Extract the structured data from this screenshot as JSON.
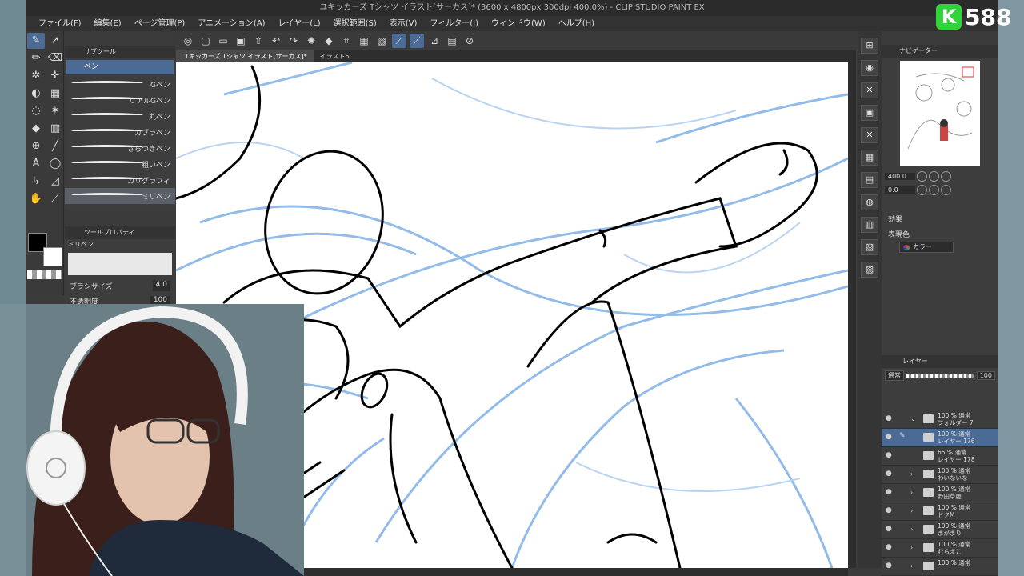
{
  "window": {
    "title": "ユキッカーズ Tシャツ イラスト[サーカス]* (3600 x 4800px 300dpi 400.0%) - CLIP STUDIO PAINT EX"
  },
  "menu": [
    "ファイル(F)",
    "編集(E)",
    "ページ管理(P)",
    "アニメーション(A)",
    "レイヤー(L)",
    "選択範囲(S)",
    "表示(V)",
    "フィルター(I)",
    "ウィンドウ(W)",
    "ヘルプ(H)"
  ],
  "subtool": {
    "header": "サブツール",
    "group": "ペン",
    "brushes": [
      "Gペン",
      "リアルGペン",
      "丸ペン",
      "カブラペン",
      "さらつきペン",
      "粗いペン",
      "カリグラフィ",
      "ミリペン"
    ]
  },
  "toolprop": {
    "header": "ツールプロパティ",
    "name": "ミリペン",
    "brush_size_label": "ブラシサイズ",
    "brush_size": "4.0",
    "opacity_label": "不透明度",
    "opacity": "100"
  },
  "canvas_tabs": [
    "ユキッカーズ Tシャツ イラスト[サーカス]*",
    "イラスト5"
  ],
  "navigator": {
    "header": "ナビゲーター",
    "zoom": "400.0",
    "rotation": "0.0"
  },
  "effect": {
    "header": "効果",
    "expression_label": "表現色",
    "expression_value": "カラー"
  },
  "layers": {
    "header": "レイヤー",
    "blend": "通常",
    "opacity": "100",
    "items": [
      {
        "line1": "100 % 通常",
        "line2": "フォルダー 7"
      },
      {
        "line1": "100 % 通常",
        "line2": "レイヤー 176"
      },
      {
        "line1": "65 % 通常",
        "line2": "レイヤー 178"
      },
      {
        "line1": "100 % 通常",
        "line2": "わいないな"
      },
      {
        "line1": "100 % 通常",
        "line2": "野田草履"
      },
      {
        "line1": "100 % 通常",
        "line2": "ドクM"
      },
      {
        "line1": "100 % 通常",
        "line2": "まがまり"
      },
      {
        "line1": "100 % 通常",
        "line2": "むらまこ"
      },
      {
        "line1": "100 % 通常",
        "line2": ""
      }
    ]
  },
  "stream": {
    "logo_letter": "K",
    "logo_number": "588",
    "logo_color": "#2fd43a"
  }
}
